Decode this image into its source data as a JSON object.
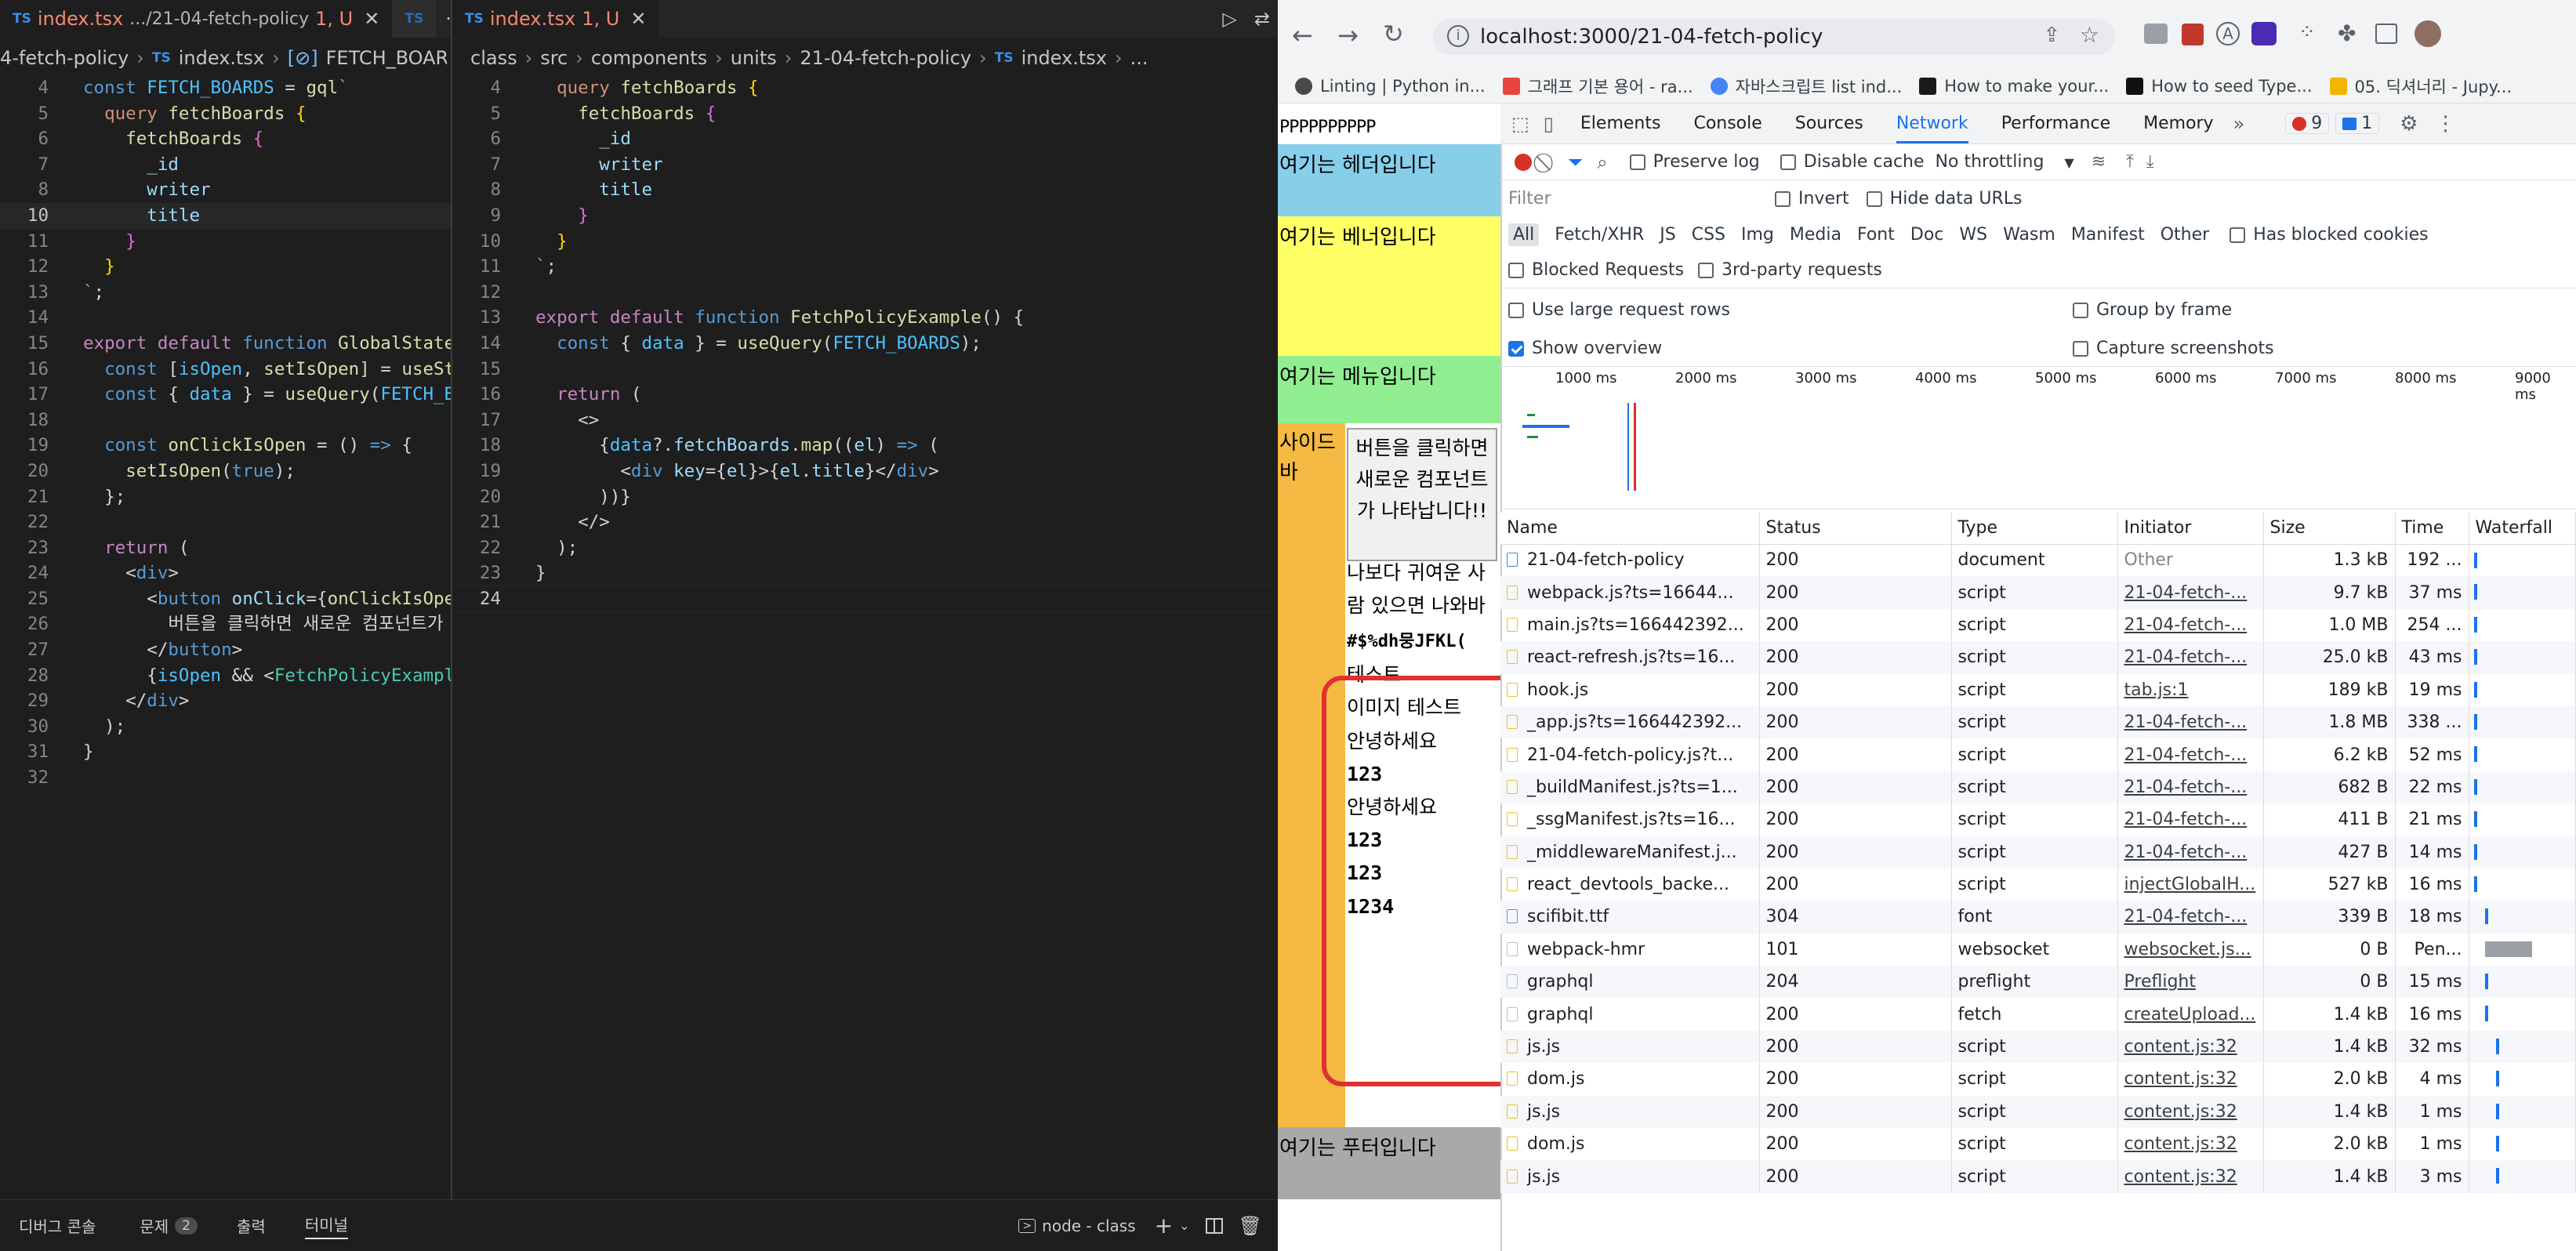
{
  "vscode": {
    "tabs": [
      {
        "lang": "TS",
        "name": "index.tsx",
        "path": ".../21-04-fetch-policy",
        "status": "1, U"
      },
      {
        "lang": "TS",
        "name": "",
        "path": "",
        "status": ""
      },
      {
        "lang": "TS",
        "name": "index.tsx",
        "path": "",
        "status": "1, U"
      }
    ],
    "left_breadcrumb": [
      "4-fetch-policy",
      "index.tsx",
      "FETCH_BOARDS"
    ],
    "right_breadcrumb": [
      "class",
      "src",
      "components",
      "units",
      "21-04-fetch-policy",
      "index.tsx",
      "..."
    ],
    "panel": {
      "debug_console": "디버그 콘솔",
      "problems": "문제",
      "problems_count": "2",
      "output": "출력",
      "terminal": "터미널",
      "terminal_name": "node - class"
    }
  },
  "browser": {
    "url": "localhost:3000/21-04-fetch-policy",
    "bookmarks": [
      {
        "label": "Linting | Python in...",
        "color": "#4a4a4a"
      },
      {
        "label": "그래프 기본 용어 - ra...",
        "color": "#e8453c"
      },
      {
        "label": "자바스크립트 list ind...",
        "color": "#4285f4"
      },
      {
        "label": "How to make your...",
        "color": "#1a1a1a"
      },
      {
        "label": "How to seed Type...",
        "color": "#111111"
      },
      {
        "label": "05. 딕셔너리 - Jupy...",
        "color": "#f4b400"
      }
    ],
    "page": {
      "top_text": "PPPPPPPPPP",
      "header": "여기는 헤더입니다",
      "banner": "여기는 베너입니다",
      "menu": "여기는 메뉴입니다",
      "sidebar": "사이드바",
      "button": "버튼을 클릭하면 새로운 컴포넌트가 나타납니다!!",
      "list": [
        "나보다 귀여운 사람 있으면 나와바",
        "#$%dh뭉JFKL(",
        "테스트",
        "이미지 테스트",
        "안녕하세요",
        "123",
        "안녕하세요",
        "123",
        "123",
        "1234"
      ],
      "footer": "여기는 푸터입니다"
    },
    "devtools": {
      "tabs": [
        "Elements",
        "Console",
        "Sources",
        "Network",
        "Performance",
        "Memory"
      ],
      "active_tab": "Network",
      "errors": "9",
      "messages": "1",
      "toolbar": {
        "preserve_log": "Preserve log",
        "disable_cache": "Disable cache",
        "throttling": "No throttling"
      },
      "filter": {
        "placeholder": "Filter",
        "invert": "Invert",
        "hide_data_urls": "Hide data URLs"
      },
      "types": [
        "All",
        "Fetch/XHR",
        "JS",
        "CSS",
        "Img",
        "Media",
        "Font",
        "Doc",
        "WS",
        "Wasm",
        "Manifest",
        "Other"
      ],
      "has_blocked_cookies": "Has blocked cookies",
      "blocked_requests": "Blocked Requests",
      "third_party": "3rd-party requests",
      "large_rows": "Use large request rows",
      "group_by_frame": "Group by frame",
      "show_overview": "Show overview",
      "capture_screenshots": "Capture screenshots",
      "timeline_ticks": [
        "1000 ms",
        "2000 ms",
        "3000 ms",
        "4000 ms",
        "5000 ms",
        "6000 ms",
        "7000 ms",
        "8000 ms",
        "9000 ms"
      ],
      "columns": [
        "Name",
        "Status",
        "Type",
        "Initiator",
        "Size",
        "Time",
        "Waterfall"
      ],
      "requests": [
        {
          "name": "21-04-fetch-policy",
          "status": "200",
          "type": "document",
          "initiator": "Other",
          "size": "1.3 kB",
          "time": "192 ...",
          "kind": "doc"
        },
        {
          "name": "webpack.js?ts=16644...",
          "status": "200",
          "type": "script",
          "initiator": "21-04-fetch-...",
          "size": "9.7 kB",
          "time": "37 ms",
          "kind": "js"
        },
        {
          "name": "main.js?ts=166442392...",
          "status": "200",
          "type": "script",
          "initiator": "21-04-fetch-...",
          "size": "1.0 MB",
          "time": "254 ...",
          "kind": "js"
        },
        {
          "name": "react-refresh.js?ts=16...",
          "status": "200",
          "type": "script",
          "initiator": "21-04-fetch-...",
          "size": "25.0 kB",
          "time": "43 ms",
          "kind": "js"
        },
        {
          "name": "hook.js",
          "status": "200",
          "type": "script",
          "initiator": "tab.js:1",
          "size": "189 kB",
          "time": "19 ms",
          "kind": "js"
        },
        {
          "name": "_app.js?ts=166442392...",
          "status": "200",
          "type": "script",
          "initiator": "21-04-fetch-...",
          "size": "1.8 MB",
          "time": "338 ...",
          "kind": "js"
        },
        {
          "name": "21-04-fetch-policy.js?t...",
          "status": "200",
          "type": "script",
          "initiator": "21-04-fetch-...",
          "size": "6.2 kB",
          "time": "52 ms",
          "kind": "js"
        },
        {
          "name": "_buildManifest.js?ts=1...",
          "status": "200",
          "type": "script",
          "initiator": "21-04-fetch-...",
          "size": "682 B",
          "time": "22 ms",
          "kind": "js"
        },
        {
          "name": "_ssgManifest.js?ts=16...",
          "status": "200",
          "type": "script",
          "initiator": "21-04-fetch-...",
          "size": "411 B",
          "time": "21 ms",
          "kind": "js"
        },
        {
          "name": "_middlewareManifest.j...",
          "status": "200",
          "type": "script",
          "initiator": "21-04-fetch-...",
          "size": "427 B",
          "time": "14 ms",
          "kind": "js"
        },
        {
          "name": "react_devtools_backe...",
          "status": "200",
          "type": "script",
          "initiator": "injectGlobalH...",
          "size": "527 kB",
          "time": "16 ms",
          "kind": "js"
        },
        {
          "name": "scifibit.ttf",
          "status": "304",
          "type": "font",
          "initiator": "21-04-fetch-...",
          "size": "339 B",
          "time": "18 ms",
          "kind": "font"
        },
        {
          "name": "webpack-hmr",
          "status": "101",
          "type": "websocket",
          "initiator": "websocket.js...",
          "size": "0 B",
          "time": "Pen...",
          "kind": "other"
        },
        {
          "name": "graphql",
          "status": "204",
          "type": "preflight",
          "initiator": "Preflight",
          "size": "0 B",
          "time": "15 ms",
          "kind": "other"
        },
        {
          "name": "graphql",
          "status": "200",
          "type": "fetch",
          "initiator": "createUpload...",
          "size": "1.4 kB",
          "time": "16 ms",
          "kind": "other"
        },
        {
          "name": "js.js",
          "status": "200",
          "type": "script",
          "initiator": "content.js:32",
          "size": "1.4 kB",
          "time": "32 ms",
          "kind": "js"
        },
        {
          "name": "dom.js",
          "status": "200",
          "type": "script",
          "initiator": "content.js:32",
          "size": "2.0 kB",
          "time": "4 ms",
          "kind": "js"
        },
        {
          "name": "js.js",
          "status": "200",
          "type": "script",
          "initiator": "content.js:32",
          "size": "1.4 kB",
          "time": "1 ms",
          "kind": "js"
        },
        {
          "name": "dom.js",
          "status": "200",
          "type": "script",
          "initiator": "content.js:32",
          "size": "2.0 kB",
          "time": "1 ms",
          "kind": "js"
        },
        {
          "name": "js.js",
          "status": "200",
          "type": "script",
          "initiator": "content.js:32",
          "size": "1.4 kB",
          "time": "3 ms",
          "kind": "js"
        }
      ]
    }
  }
}
